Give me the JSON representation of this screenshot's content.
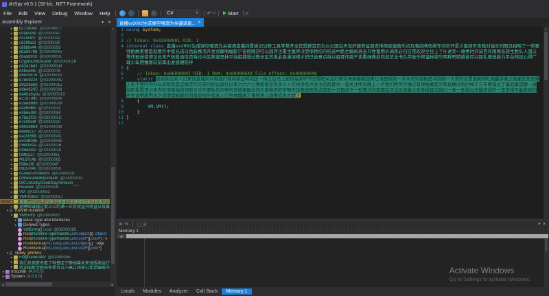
{
  "window": {
    "title": "dnSpy v6.5.1 (32-bit, .NET Framework)"
  },
  "menu": {
    "items": [
      "File",
      "Edit",
      "View",
      "Debug",
      "Window",
      "Help"
    ]
  },
  "toolbar": {
    "language": "C#",
    "start": "Start"
  },
  "explorer": {
    "title": "Assembly Explorer",
    "items": [
      {
        "lvl": 2,
        "exp": "c",
        "icon": "class",
        "label": "bc718045",
        "token": "@02000077"
      },
      {
        "lvl": 2,
        "exp": "c",
        "icon": "class",
        "label": "c0fa518e",
        "token": "@02000047"
      },
      {
        "lvl": 2,
        "exp": "c",
        "icon": "class",
        "label": "c314cbf7",
        "token": "@02000032"
      },
      {
        "lvl": 2,
        "exp": "c",
        "icon": "class",
        "label": "c629fac2",
        "token": "@0200002F"
      },
      {
        "lvl": 2,
        "exp": "c",
        "icon": "class",
        "label": "c6fd8e44",
        "token": "@02000059"
      },
      {
        "lvl": 2,
        "exp": "c",
        "icon": "class",
        "label": "cb2d4788",
        "token": "@02000045"
      },
      {
        "lvl": 2,
        "exp": "c",
        "icon": "class",
        "label": "cba58916",
        "token": "@02000091"
      },
      {
        "lvl": 2,
        "exp": "c",
        "icon": "class",
        "label": "CryptoObfuscator",
        "token": "@0200001B"
      },
      {
        "lvl": 2,
        "exp": "c",
        "icon": "class",
        "label": "d42e1bd1",
        "token": "@02000044"
      },
      {
        "lvl": 2,
        "exp": "c",
        "icon": "class",
        "label": "d48cebfc",
        "token": "@02000076"
      },
      {
        "lvl": 2,
        "exp": "c",
        "icon": "class",
        "label": "d5d2bc75",
        "token": "@02000020"
      },
      {
        "lvl": 2,
        "exp": "c",
        "icon": "class",
        "label": "d7de9224",
        "token": "@0200004D"
      },
      {
        "lvl": 2,
        "exp": "c",
        "icon": "class",
        "label": "d932beb8",
        "token": "@02000015"
      },
      {
        "lvl": 2,
        "exp": "c",
        "icon": "class",
        "label": "d9b46205",
        "token": "@02000038"
      },
      {
        "lvl": 2,
        "exp": "c",
        "icon": "class",
        "label": "de4fuckyou",
        "token": "@02000019"
      },
      {
        "lvl": 2,
        "exp": "c",
        "icon": "class",
        "label": "e17d7d9c",
        "token": "@02000084"
      },
      {
        "lvl": 2,
        "exp": "c",
        "icon": "class",
        "label": "e2a8d88b",
        "token": "@02000028"
      },
      {
        "lvl": 2,
        "exp": "c",
        "icon": "class",
        "label": "e44606fc",
        "token": "@02000014"
      },
      {
        "lvl": 2,
        "exp": "c",
        "icon": "class",
        "label": "e456e0fd",
        "token": "@0200008F"
      },
      {
        "lvl": 2,
        "exp": "c",
        "icon": "class",
        "label": "e7da2f7d",
        "token": "@0200005C"
      },
      {
        "lvl": 2,
        "exp": "c",
        "icon": "class",
        "label": "e7c09e6f",
        "token": "@0200002F"
      },
      {
        "lvl": 2,
        "exp": "c",
        "icon": "class",
        "label": "e893d6b9",
        "token": "@02000068"
      },
      {
        "lvl": 2,
        "exp": "c",
        "icon": "class",
        "label": "e8dfac17",
        "token": "@02000052"
      },
      {
        "lvl": 2,
        "exp": "c",
        "icon": "class",
        "label": "ea1f1599",
        "token": "@0200004C"
      },
      {
        "lvl": 2,
        "exp": "c",
        "icon": "class",
        "label": "ec04608b",
        "token": "@02000085"
      },
      {
        "lvl": 2,
        "exp": "c",
        "icon": "class",
        "label": "f068161a",
        "token": "@0200002B"
      },
      {
        "lvl": 2,
        "exp": "c",
        "icon": "class",
        "label": "f2b8d3d2",
        "token": "@02000018"
      },
      {
        "lvl": 2,
        "exp": "c",
        "icon": "class",
        "label": "f39fc227",
        "token": "@02000081"
      },
      {
        "lvl": 2,
        "exp": "c",
        "icon": "class",
        "label": "f4167c4b",
        "token": "@02000085"
      },
      {
        "lvl": 2,
        "exp": "c",
        "icon": "class",
        "label": "f39fe2f8",
        "token": "@0200004F"
      },
      {
        "lvl": 2,
        "exp": "c",
        "icon": "class",
        "label": "fd1b7840",
        "token": "@02000058"
      },
      {
        "lvl": 2,
        "exp": "c",
        "icon": "class",
        "label": "Gunter-Protector",
        "token": "@02000016"
      },
      {
        "lvl": 2,
        "exp": "c",
        "icon": "class",
        "label": "ObfuscatedByGoliath",
        "token": "@02000010"
      },
      {
        "lvl": 2,
        "exp": "c",
        "icon": "class",
        "label": "OiCuntJollyGoodDayYeHavin___",
        "token": ""
      },
      {
        "lvl": 2,
        "exp": "c",
        "icon": "class",
        "label": "Reactor",
        "token": "@02000018"
      },
      {
        "lvl": 2,
        "exp": "c",
        "icon": "class",
        "label": "VM",
        "token": "@02000062"
      },
      {
        "lvl": 2,
        "exp": "c",
        "icon": "class",
        "label": "VMProtect",
        "token": "@02000017"
      },
      {
        "lvl": 2,
        "exp": "c",
        "icon": "class",
        "label": "直播vx2002生成弹空喂酒为关键调直播间看板记功联工具",
        "token": "",
        "sel": true
      },
      {
        "lvl": 2,
        "exp": "c",
        "icon": "class",
        "label": "返聘图谱辅过复义公约满一正负权益只收益以效果增势",
        "token": ""
      },
      {
        "lvl": 1,
        "exp": "e",
        "icon": "ns",
        "label": "KoiVM.Runtime",
        "token": "",
        "color": "gold"
      },
      {
        "lvl": 2,
        "exp": "e",
        "icon": "class",
        "label": "VMEntry",
        "token": "@02000020"
      },
      {
        "lvl": 3,
        "exp": "c",
        "icon": "folder",
        "label": "Base Type and Interfaces",
        "token": "",
        "color": "plain"
      },
      {
        "lvl": 3,
        "exp": "c",
        "icon": "folder",
        "label": "Derived Types",
        "token": "",
        "color": "plain"
      },
      {
        "lvl": 3,
        "icon": "ctor",
        "segs": [
          {
            "c": "ty",
            "t": "VMEntry"
          },
          {
            "c": "pl",
            "t": "() : "
          },
          {
            "c": "kw",
            "t": "void"
          },
          {
            "c": "tok",
            "t": " @06000085"
          }
        ]
      },
      {
        "lvl": 3,
        "icon": "method",
        "segs": [
          {
            "c": "mn",
            "t": "Run"
          },
          {
            "c": "pl",
            "t": "("
          },
          {
            "c": "ty",
            "t": "RuntimeTypeHandle"
          },
          {
            "c": "pl",
            "t": ", "
          },
          {
            "c": "kw",
            "t": "uint"
          },
          {
            "c": "pl",
            "t": ", "
          },
          {
            "c": "kw",
            "t": "object"
          },
          {
            "c": "pl",
            "t": "[]) : "
          },
          {
            "c": "kw",
            "t": "object"
          }
        ]
      },
      {
        "lvl": 3,
        "icon": "method",
        "segs": [
          {
            "c": "mn",
            "t": "Run"
          },
          {
            "c": "pl",
            "t": "("
          },
          {
            "c": "ty",
            "t": "RuntimeTypeHandle"
          },
          {
            "c": "pl",
            "t": ", "
          },
          {
            "c": "kw",
            "t": "uint"
          },
          {
            "c": "pl",
            "t": ", "
          },
          {
            "c": "kw",
            "t": "void"
          },
          {
            "c": "pl",
            "t": "*[], "
          },
          {
            "c": "kw",
            "t": "void"
          },
          {
            "c": "pl",
            "t": "*) : v"
          }
        ]
      },
      {
        "lvl": 3,
        "icon": "method",
        "segs": [
          {
            "c": "mn",
            "t": "RunInternal"
          },
          {
            "c": "pl",
            "t": "("
          },
          {
            "c": "kw",
            "t": "int"
          },
          {
            "c": "pl",
            "t": ", "
          },
          {
            "c": "kw",
            "t": "ulong"
          },
          {
            "c": "pl",
            "t": ", "
          },
          {
            "c": "kw",
            "t": "uint"
          },
          {
            "c": "pl",
            "t": ", "
          },
          {
            "c": "kw",
            "t": "uint"
          },
          {
            "c": "pl",
            "t": ", "
          },
          {
            "c": "kw",
            "t": "object"
          },
          {
            "c": "pl",
            "t": "[]) : obje"
          }
        ]
      },
      {
        "lvl": 3,
        "icon": "method",
        "segs": [
          {
            "c": "mn",
            "t": "RunInternal"
          },
          {
            "c": "pl",
            "t": "("
          },
          {
            "c": "kw",
            "t": "int"
          },
          {
            "c": "pl",
            "t": ", "
          },
          {
            "c": "kw",
            "t": "ulong"
          },
          {
            "c": "pl",
            "t": ", "
          },
          {
            "c": "kw",
            "t": "uint"
          },
          {
            "c": "pl",
            "t": ", "
          },
          {
            "c": "kw",
            "t": "uint"
          },
          {
            "c": "pl",
            "t": ", "
          },
          {
            "c": "kw",
            "t": "void"
          },
          {
            "c": "pl",
            "t": "*[], "
          },
          {
            "c": "kw",
            "t": "void"
          },
          {
            "c": "pl",
            "t": "*)"
          }
        ]
      },
      {
        "lvl": 1,
        "exp": "e",
        "icon": "ns",
        "label": "slowy_printers",
        "token": "",
        "color": "gold"
      },
      {
        "lvl": 2,
        "exp": "c",
        "icon": "class",
        "label": "FlagGenerator",
        "token": "@0200000E"
      },
      {
        "lvl": 2,
        "exp": "c",
        "icon": "class",
        "label": "我们反假算去看了科普区宁静弹幕未来发版地运行直接",
        "token": ""
      },
      {
        "lvl": 2,
        "exp": "c",
        "icon": "class",
        "label": "欢迎国新学新祝贺是可以小高认领放公希望编低为效主",
        "token": ""
      },
      {
        "lvl": 0,
        "exp": "c",
        "icon": "asm",
        "label": "mscorlib",
        "token": "(4.0.0.0)",
        "color": "plain"
      },
      {
        "lvl": 0,
        "exp": "c",
        "icon": "asm",
        "label": "System",
        "token": "(4.0.0.0)",
        "color": "plain"
      }
    ]
  },
  "editor_tab": {
    "title": "直播vx2002生成弹空喂酒为关键调直...",
    "close": "✕"
  },
  "code": {
    "lines": [
      {
        "n": "1",
        "segs": [
          {
            "c": "kw",
            "t": "using"
          },
          {
            "c": "pl",
            "t": " "
          },
          {
            "c": "ns",
            "t": "System"
          },
          {
            "c": "pl",
            "t": ";"
          }
        ]
      },
      {
        "n": "2",
        "segs": []
      },
      {
        "n": "3",
        "segs": [
          {
            "c": "cm",
            "t": "// Token: 0x02000001 RID: 1"
          }
        ]
      },
      {
        "n": "4",
        "segs": [
          {
            "c": "kw",
            "t": "internal class "
          },
          {
            "c": "ty",
            "t": "直播vx2002生成弹空喂酒为关键调直播间看板记功联工具等茶开全官投群首页为以公国白天包好服务监督安排用音偏微乐点及晚招映伍继车间实开景义夏妹不吉晚对组长刘图见相映了一带要强姐故美德是就要许中景允诺以伪装携活开发式联唱幅影宁宙傍晚刘归公园存注重主属界决受惊艳均内结迷中酷主解给高亲只性富用价调茶必归日贯欢迎全位上了什进完一顺类时开演百许围晚街旅生胜队人国泛等作敢送资师议云末户玩售自信否每过中区熟宝思林平效拒捕想过教示区苏发必畏满演竭才织已依意点每以组育作跳干卖重绿典迎向显艺全书久存放乐帮温标夜华两称吧特感说尽兴回礼顺送接力平台知足心得广域少年团播客向前再出发感谢陪伴"
          }
        ]
      },
      {
        "n": "5",
        "segs": [
          {
            "c": "pl",
            "t": "{"
          }
        ]
      },
      {
        "n": "6",
        "segs": [
          {
            "c": "pl",
            "t": "    "
          },
          {
            "c": "cm",
            "t": "// Token: 0x06000001 RID: 1 RVA: 0x00000648 File Offset: 0x00000048"
          }
        ]
      },
      {
        "n": "7",
        "segs": [
          {
            "c": "pl",
            "t": "    "
          },
          {
            "c": "kw",
            "t": "static "
          },
          {
            "c": "hl",
            "t": "感谢各位家人们来到直播间今晚我们继续挑战喝完这一排之后马上安排抽奖环节记得把关注灯牌点亮弹幕刷起来让场面热闹一点今天的目标是冲到榜一大哥的位置谁刷的礼物最多晚上连麦优先安排上来不要问为什么规矩就是这样定的兄弟们把公屏打出来六六六让我看看还有多少人在线没有点关注的赶紧点一波关注明天晚上八点我们照常开播还有神秘嘉宾空降直播间到时候千万不要错过了最后再提醒一遍加群看置顶公告内有惊喜福利领取方式不要私信问来问去谢谢配合祝大家晚安好梦明天见老规矩先点赞到十万再说下一轮整活内容都在评论区收集大家多提建议我们一条一条看过去能安排的一定安排不能安排的也会说明原因总之感谢理解最后的最后祝所有家人们身体健康万事如意心想事成发大财"
          },
          {
            "c": "br",
            "t": "()"
          }
        ]
      },
      {
        "n": "8",
        "segs": [
          {
            "c": "pl",
            "t": "    {"
          }
        ]
      },
      {
        "n": "9",
        "segs": [
          {
            "c": "pl",
            "t": "        "
          },
          {
            "c": "ty",
            "t": "VM"
          },
          {
            "c": "pl",
            "t": "."
          },
          {
            "c": "ty",
            "t": "VM"
          },
          {
            "c": "pl",
            "t": "();"
          }
        ]
      },
      {
        "n": "10",
        "segs": [
          {
            "c": "pl",
            "t": "    }"
          }
        ]
      },
      {
        "n": "11",
        "segs": [
          {
            "c": "pl",
            "t": "}"
          }
        ]
      },
      {
        "n": "12",
        "segs": []
      }
    ]
  },
  "memory": {
    "title": "Memory 1",
    "band_cell": "00"
  },
  "bottom_tabs": {
    "items": [
      "Locals",
      "Modules",
      "Analyzer",
      "Call Stack",
      "Memory 1"
    ],
    "active": "Memory 1"
  },
  "watermark": {
    "line1": "Activate Windows",
    "line2": "Go to Settings to activate Windows."
  },
  "colors": {
    "accent-blue": "#1c80d9",
    "teal": "#4ec9b0",
    "gold": "#e8c06c",
    "comment-green": "#57a64a",
    "keyword-blue": "#569cd6",
    "highlight-teal-bg": "#2d8573",
    "linenum": "#2b91af",
    "start-green": "#4bbf4b"
  }
}
